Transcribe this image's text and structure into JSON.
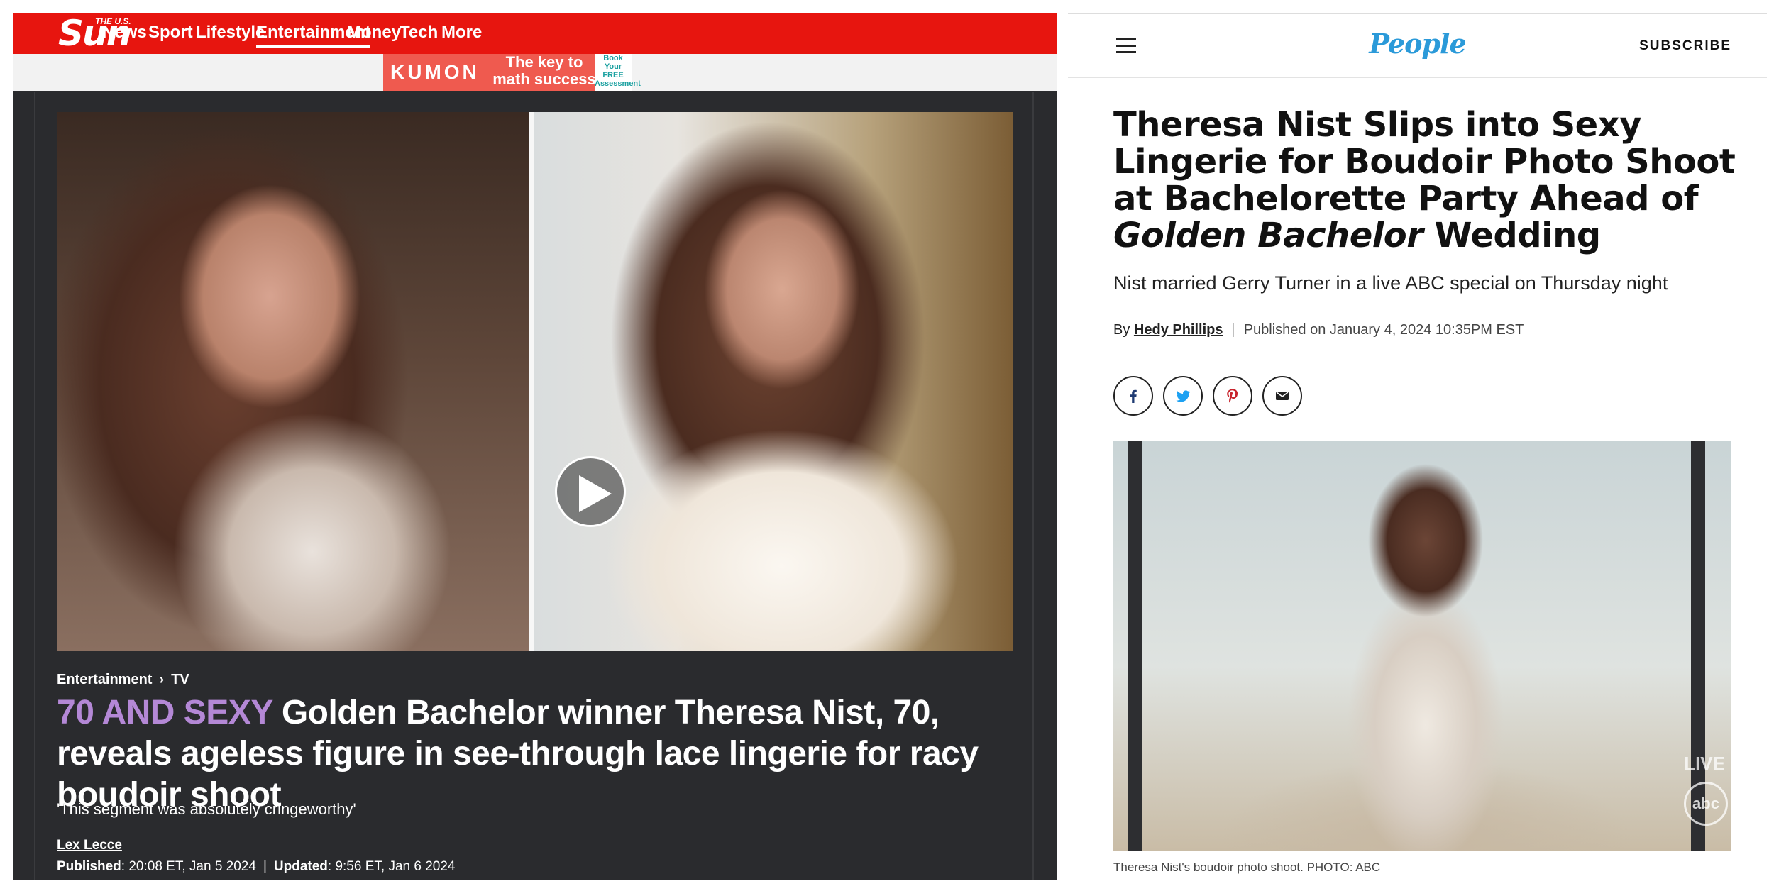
{
  "sun": {
    "logo_small": "THE U.S.",
    "logo_big": "Sun",
    "nav": [
      "News",
      "Sport",
      "Lifestyle",
      "Entertainment",
      "Money",
      "Tech",
      "More"
    ],
    "nav_active": "Entertainment",
    "ad": {
      "brand": "KUMON",
      "tagline": "The key to math success",
      "cta": "Book Your FREE Assessment"
    },
    "breadcrumb": [
      "Entertainment",
      "TV"
    ],
    "kicker": "70 AND SEXY",
    "headline": "Golden Bachelor winner Theresa Nist, 70, reveals ageless figure in see-through lace lingerie for racy boudoir shoot",
    "standfirst": "'This segment was absolutely cringeworthy'",
    "author": "Lex Lecce",
    "published_label": "Published",
    "published": "20:08 ET, Jan 5 2024",
    "updated_label": "Updated",
    "updated": "9:56 ET, Jan 6 2024",
    "colors": {
      "nav": "#e7150f",
      "kicker": "#b488d6",
      "card": "#2a2b2e"
    }
  },
  "people": {
    "logo": "People",
    "subscribe": "SUBSCRIBE",
    "headline_part1": "Theresa Nist Slips into Sexy Lingerie for Boudoir Photo Shoot at Bachelorette Party Ahead of ",
    "headline_italic": "Golden Bachelor",
    "headline_part2": " Wedding",
    "dek": "Nist married Gerry Turner in a live ABC special on Thursday night",
    "by_label": "By",
    "author": "Hedy Phillips",
    "published": "Published on January 4, 2024 10:35PM EST",
    "share_icons": [
      "facebook-icon",
      "twitter-icon",
      "pinterest-icon",
      "email-icon"
    ],
    "photo_live": "LIVE",
    "photo_network": "abc",
    "caption": "Theresa Nist's boudoir photo shoot. PHOTO: ABC",
    "colors": {
      "logo": "#2b9ad9"
    }
  }
}
